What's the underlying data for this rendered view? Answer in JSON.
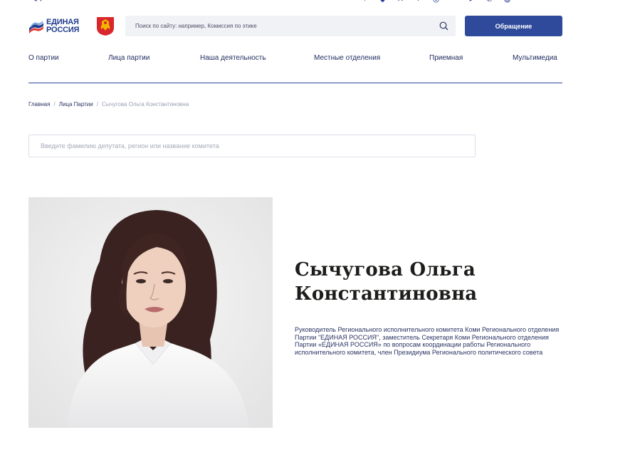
{
  "header": {
    "logo_text_line1": "ЕДИНАЯ",
    "logo_text_line2": "РОССИЯ",
    "search_placeholder": "Поиск по сайту: например, Комиссия по этике",
    "appeal_label": "Обращение",
    "brand_color": "#2f4a9a",
    "social_icons": [
      "twitter-icon",
      "odnoklassniki-icon",
      "x-icon",
      "facebook-icon",
      "instagram-icon",
      "vk-icon",
      "telegram-icon",
      "phone-icon",
      "globe-icon"
    ]
  },
  "nav": {
    "items": [
      {
        "label": "О партии"
      },
      {
        "label": "Лица партии"
      },
      {
        "label": "Наша деятельность"
      },
      {
        "label": "Местные отделения"
      },
      {
        "label": "Приемная"
      },
      {
        "label": "Мультимедиа"
      }
    ]
  },
  "breadcrumb": {
    "home": "Главная",
    "section": "Лица Партии",
    "current": "Сычугова Ольга Константиновна",
    "separator": "/"
  },
  "deputy_search": {
    "placeholder": "Введите фамилию депутата, регион или название комитета"
  },
  "person": {
    "name_line1": "Сычугова Ольга",
    "name_line2": "Константиновна",
    "bio": "Руководитель Регионального исполнительного комитета Коми Регионального отделения Партии \"ЕДИНАЯ РОССИЯ\", заместитель Секретаря Коми Регионального отделения Партии «ЕДИНАЯ РОССИЯ» по вопросам координации работы Регионального исполнительного комитета, член Президиума Регионального политического совета"
  }
}
